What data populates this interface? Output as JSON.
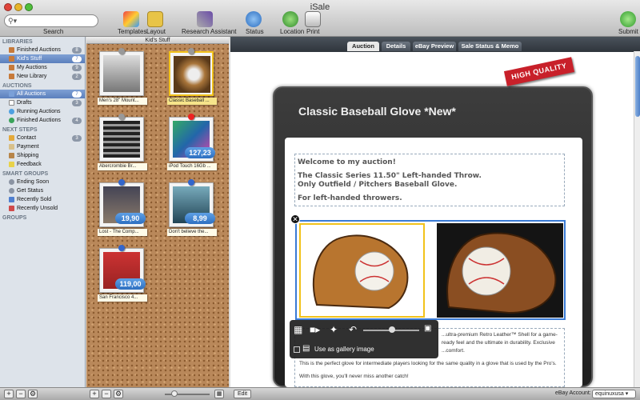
{
  "window": {
    "title": "iSale"
  },
  "toolbar": {
    "search_label": "Search",
    "templates": "Templates",
    "layout": "Layout",
    "research": "Research Assistant",
    "status": "Status",
    "location": "Location",
    "print": "Print",
    "submit": "Submit"
  },
  "sidebar": {
    "libraries_header": "LIBRARIES",
    "libraries": [
      {
        "label": "Finished Auctions",
        "count": "8"
      },
      {
        "label": "Kid's Stuff",
        "count": "7"
      },
      {
        "label": "My Auctions",
        "count": "9"
      },
      {
        "label": "New Library",
        "count": "2"
      }
    ],
    "auctions_header": "AUCTIONS",
    "auctions": [
      {
        "label": "All Auctions",
        "count": "7"
      },
      {
        "label": "Drafts",
        "count": "3"
      },
      {
        "label": "Running Auctions",
        "count": ""
      },
      {
        "label": "Finished Auctions",
        "count": "4"
      }
    ],
    "next_steps_header": "NEXT STEPS",
    "next_steps": [
      {
        "label": "Contact",
        "count": "3"
      },
      {
        "label": "Payment",
        "count": ""
      },
      {
        "label": "Shipping",
        "count": ""
      },
      {
        "label": "Feedback",
        "count": ""
      }
    ],
    "smart_groups_header": "SMART GROUPS",
    "smart_groups": [
      {
        "label": "Ending Soon"
      },
      {
        "label": "Get Status"
      },
      {
        "label": "Recently Sold"
      },
      {
        "label": "Recently Unsold"
      }
    ],
    "groups_header": "GROUPS"
  },
  "board": {
    "title": "Kid's Stuff",
    "items": [
      {
        "caption": "Men's 28\" Mount...",
        "price": ""
      },
      {
        "caption": "Classic Baseball ...",
        "price": ""
      },
      {
        "caption": "Abercrombie Br...",
        "price": ""
      },
      {
        "caption": "iPod Touch 16Gb ...",
        "price": "127,23"
      },
      {
        "caption": "Lost - The Comp...",
        "price": "19,90"
      },
      {
        "caption": "Don't believe the...",
        "price": "8,99"
      },
      {
        "caption": "San Francisco 4...",
        "price": "119,00"
      }
    ]
  },
  "tabs": [
    "Auction",
    "Details",
    "eBay Preview",
    "Sale Status & Memo"
  ],
  "listing": {
    "badge": "HIGH QUALITY",
    "title": "Classic Baseball Glove *New*",
    "desc_lines": [
      "Welcome to my auction!",
      "",
      "The Classic Series 11.50\" Left-handed Throw.",
      "Only Outfield / Pitchers Baseball Glove.",
      "",
      "For left-handed throwers."
    ],
    "gallery_label": "Use as gallery image",
    "body_lines": [
      "...ultra-premium Retro Leather™ Shell for a game-ready feel and the ultimate in durability. Exclusive",
      "...comfort.",
      "This is the perfect glove for intermediate players looking for the same quality in a glove that is used by the Pro's.",
      "With this glove, you'll never miss another catch!"
    ]
  },
  "bottom": {
    "edit": "Edit",
    "ebay_account_label": "eBay Account:",
    "ebay_account": "equinuxusa"
  },
  "colors": {
    "accent": "#5b7fbd",
    "badge_red": "#c8202a",
    "price_blue": "#2d6fc0"
  }
}
